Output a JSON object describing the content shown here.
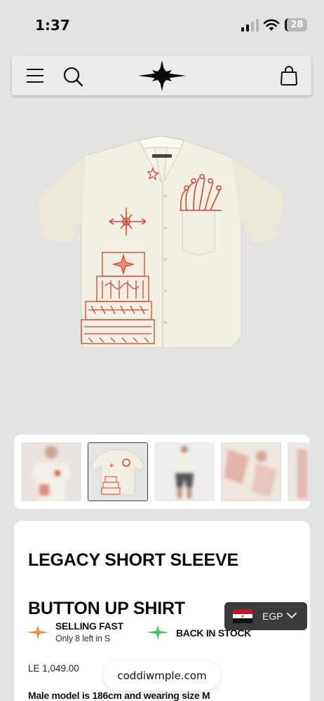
{
  "status_bar": {
    "time": "1:37",
    "battery_level": "28",
    "icons": [
      "signal-icon",
      "wifi-icon",
      "battery-icon"
    ]
  },
  "header": {
    "icons": [
      "menu-icon",
      "search-icon",
      "logo-star-icon",
      "cart-bag-icon"
    ]
  },
  "gallery": {
    "thumbnail_count": 5,
    "selected_index": 1
  },
  "product": {
    "title": "LEGACY SHORT SLEEVE BUTTON UP SHIRT",
    "badges": {
      "selling_fast": "SELLING FAST",
      "selling_fast_note": "Only 8 left in S",
      "back_in_stock": "BACK IN STOCK"
    },
    "price": "LE 1,049.00",
    "model_note": "Male model is 186cm and wearing size M"
  },
  "currency": {
    "code": "EGP",
    "flag": "egypt-flag-icon"
  },
  "browser": {
    "url": "coddiwmple.com"
  },
  "colors": {
    "background": "#e3e3e3",
    "card": "#ffffff",
    "print_red": "#d9432f",
    "selling_fast_orange": "#ef8a3c",
    "back_in_stock_green": "#35c75a",
    "currency_bg": "#3b3b3b"
  }
}
